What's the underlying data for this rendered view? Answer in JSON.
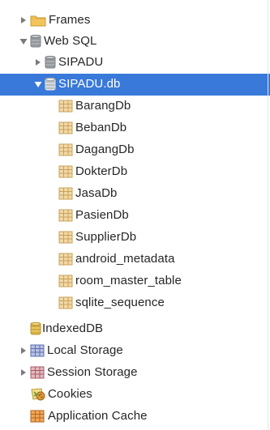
{
  "tree": {
    "frames": {
      "label": "Frames",
      "icon": "folder-icon",
      "state": "collapsed"
    },
    "web_sql": {
      "label": "Web SQL",
      "icon": "database-icon",
      "state": "expanded",
      "databases": [
        {
          "label": "SIPADU",
          "icon": "database-icon",
          "state": "collapsed"
        },
        {
          "label": "SIPADU.db",
          "icon": "database-icon",
          "state": "expanded",
          "selected": true,
          "tables": [
            {
              "label": "BarangDb",
              "icon": "table-icon"
            },
            {
              "label": "BebanDb",
              "icon": "table-icon"
            },
            {
              "label": "DagangDb",
              "icon": "table-icon"
            },
            {
              "label": "DokterDb",
              "icon": "table-icon"
            },
            {
              "label": "JasaDb",
              "icon": "table-icon"
            },
            {
              "label": "PasienDb",
              "icon": "table-icon"
            },
            {
              "label": "SupplierDb",
              "icon": "table-icon"
            },
            {
              "label": "android_metadata",
              "icon": "table-icon"
            },
            {
              "label": "room_master_table",
              "icon": "table-icon"
            },
            {
              "label": "sqlite_sequence",
              "icon": "table-icon"
            }
          ]
        }
      ]
    },
    "indexed_db": {
      "label": "IndexedDB",
      "icon": "database-icon"
    },
    "local_storage": {
      "label": "Local Storage",
      "icon": "storage-grid-icon",
      "state": "collapsed"
    },
    "session_storage": {
      "label": "Session Storage",
      "icon": "storage-grid-icon",
      "state": "collapsed"
    },
    "cookies": {
      "label": "Cookies",
      "icon": "cookie-icon"
    },
    "application_cache": {
      "label": "Application Cache",
      "icon": "cache-grid-icon"
    }
  },
  "colors": {
    "selection": "#3879d9",
    "text": "#262626",
    "folder": "#f0c458",
    "database": "#9aa0a6",
    "table": "#e8c98a",
    "local_storage": "#6b7fb8",
    "session_storage": "#b56a72",
    "cache": "#d9822b"
  }
}
